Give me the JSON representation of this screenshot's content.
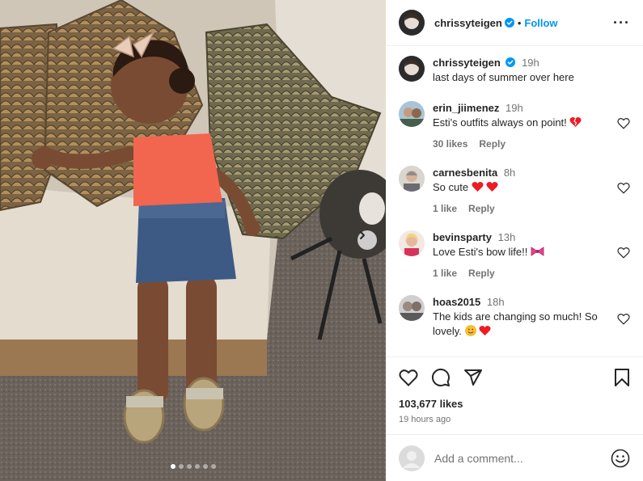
{
  "post": {
    "author": "chrissyteigen",
    "follow_label": "Follow",
    "separator": "•",
    "more_label": "···",
    "caption": "last days of summer over here",
    "caption_time": "19h",
    "likes": "103,677 likes",
    "time_ago": "19 hours ago",
    "carousel_dots": 6,
    "carousel_index": 0
  },
  "comments": [
    {
      "user": "erin_jiimenez",
      "time": "19h",
      "text": "Esti's outfits always on point!",
      "emoji": [
        "broken-heart-icon"
      ],
      "likes": "30 likes",
      "reply": "Reply"
    },
    {
      "user": "carnesbenita",
      "time": "8h",
      "text": "So cute",
      "emoji": [
        "red-heart-icon",
        "red-heart-icon"
      ],
      "likes": "1 like",
      "reply": "Reply"
    },
    {
      "user": "bevinsparty",
      "time": "13h",
      "text": "Love Esti's bow life!!",
      "emoji": [
        "ribbon-icon"
      ],
      "likes": "1 like",
      "reply": "Reply"
    },
    {
      "user": "hoas2015",
      "time": "18h",
      "text": "The kids are changing so much! So lovely.",
      "emoji": [
        "smiling-face-icon",
        "red-heart-icon"
      ],
      "likes": "",
      "reply": ""
    }
  ],
  "composer": {
    "placeholder": "Add a comment..."
  },
  "colors": {
    "accent": "#0095f6",
    "text": "#262626",
    "secondary": "#737373",
    "heart": "#ed1c24"
  },
  "icons": [
    "more-options-icon",
    "verified-badge-icon",
    "heart-icon",
    "comment-icon",
    "share-icon",
    "bookmark-icon",
    "emoji-icon",
    "chevron-right-icon"
  ]
}
